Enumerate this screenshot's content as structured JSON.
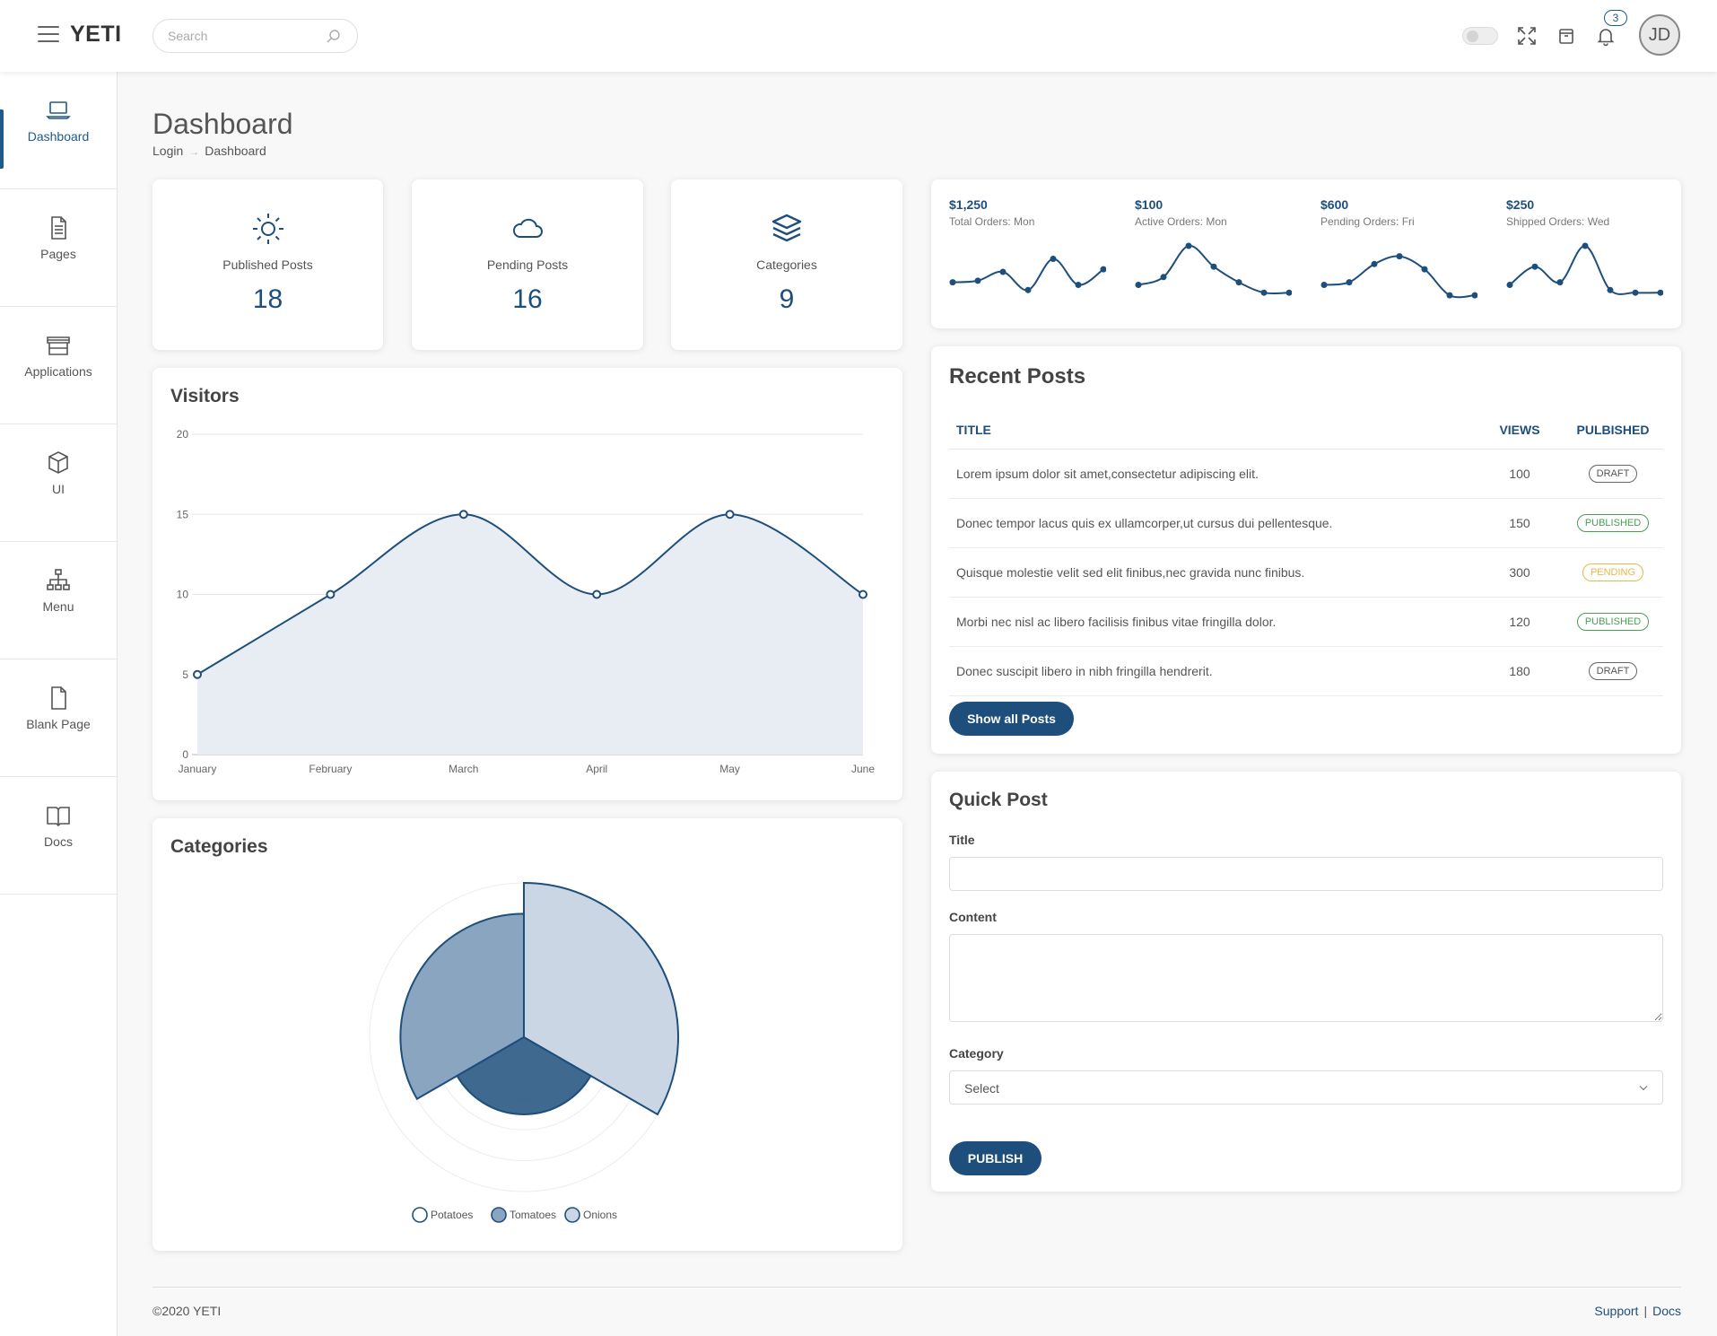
{
  "app": {
    "logo": "YETI"
  },
  "topbar": {
    "search_placeholder": "Search",
    "notifications_count": "3",
    "avatar_initials": "JD",
    "icons": [
      "menu-icon",
      "search-icon",
      "toggle-switch",
      "fullscreen-icon",
      "archive-icon",
      "bell-icon"
    ]
  },
  "sidebar": {
    "items": [
      {
        "label": "Dashboard",
        "icon": "laptop-icon",
        "active": true
      },
      {
        "label": "Pages",
        "icon": "document-icon"
      },
      {
        "label": "Applications",
        "icon": "store-icon"
      },
      {
        "label": "UI",
        "icon": "cube-icon"
      },
      {
        "label": "Menu",
        "icon": "hierarchy-icon"
      },
      {
        "label": "Blank Page",
        "icon": "blank-page-icon"
      },
      {
        "label": "Docs",
        "icon": "book-icon"
      }
    ]
  },
  "page": {
    "title": "Dashboard",
    "breadcrumb": [
      "Login",
      "Dashboard"
    ]
  },
  "stats": [
    {
      "label": "Published Posts",
      "value": "18",
      "icon": "sun-icon"
    },
    {
      "label": "Pending Posts",
      "value": "16",
      "icon": "cloud-icon"
    },
    {
      "label": "Categories",
      "value": "9",
      "icon": "layers-icon"
    }
  ],
  "sparklines": [
    {
      "value": "$1,250",
      "label": "Total Orders: Mon",
      "points": [
        3,
        3.3,
        5,
        1.5,
        7.5,
        2.5,
        5.5
      ]
    },
    {
      "value": "$100",
      "label": "Active Orders: Mon",
      "points": [
        2.5,
        4,
        10,
        6,
        3,
        1,
        1
      ]
    },
    {
      "value": "$600",
      "label": "Pending Orders: Fri",
      "points": [
        2.5,
        3,
        6.5,
        8,
        5.5,
        0.5,
        0.5
      ]
    },
    {
      "value": "$250",
      "label": "Shipped Orders: Wed",
      "points": [
        2.5,
        6,
        3,
        10,
        1.5,
        1,
        1
      ]
    }
  ],
  "recent_posts": {
    "title": "Recent Posts",
    "columns": [
      "TITLE",
      "VIEWS",
      "PULBISHED"
    ],
    "rows": [
      {
        "title": "Lorem ipsum dolor sit amet,consectetur adipiscing elit.",
        "views": "100",
        "status": "DRAFT",
        "status_type": "draft"
      },
      {
        "title": "Donec tempor lacus quis ex ullamcorper,ut cursus dui pellentesque.",
        "views": "150",
        "status": "PUBLISHED",
        "status_type": "published"
      },
      {
        "title": "Quisque molestie velit sed elit finibus,nec gravida nunc finibus.",
        "views": "300",
        "status": "PENDING",
        "status_type": "pending"
      },
      {
        "title": "Morbi nec nisl ac libero facilisis finibus vitae fringilla dolor.",
        "views": "120",
        "status": "PUBLISHED",
        "status_type": "published"
      },
      {
        "title": "Donec suscipit libero in nibh fringilla hendrerit.",
        "views": "180",
        "status": "DRAFT",
        "status_type": "draft"
      }
    ],
    "button": "Show all Posts"
  },
  "quick_post": {
    "title": "Quick Post",
    "title_label": "Title",
    "title_value": "",
    "content_label": "Content",
    "content_value": "",
    "category_label": "Category",
    "category_value": "Select",
    "button": "PUBLISH"
  },
  "visitors_card": {
    "title": "Visitors"
  },
  "categories_card": {
    "title": "Categories"
  },
  "chart_data": [
    {
      "type": "area",
      "title": "Visitors",
      "categories": [
        "January",
        "February",
        "March",
        "April",
        "May",
        "June"
      ],
      "values": [
        5,
        10,
        15,
        10,
        15,
        10
      ],
      "ylim": [
        0,
        20
      ],
      "yticks": [
        0,
        5,
        10,
        15,
        20
      ],
      "grid": true,
      "colors": {
        "line": "#1e4f7c",
        "fill": "#e8ecf3"
      }
    },
    {
      "type": "polarArea",
      "title": "Categories",
      "categories": [
        "Potatoes",
        "Tomatoes",
        "Onions"
      ],
      "values": [
        5,
        8,
        10
      ],
      "rmax": 10,
      "legend": "bottom",
      "colors": [
        "#1e4f7c",
        "#8aa5c0",
        "#cad6e3"
      ]
    }
  ],
  "footer": {
    "copyright": "©2020 YETI",
    "links": [
      "Support",
      "Docs"
    ]
  },
  "colors": {
    "primary": "#1e4f7c",
    "published": "#4a9e55",
    "pending": "#e6b84a"
  }
}
